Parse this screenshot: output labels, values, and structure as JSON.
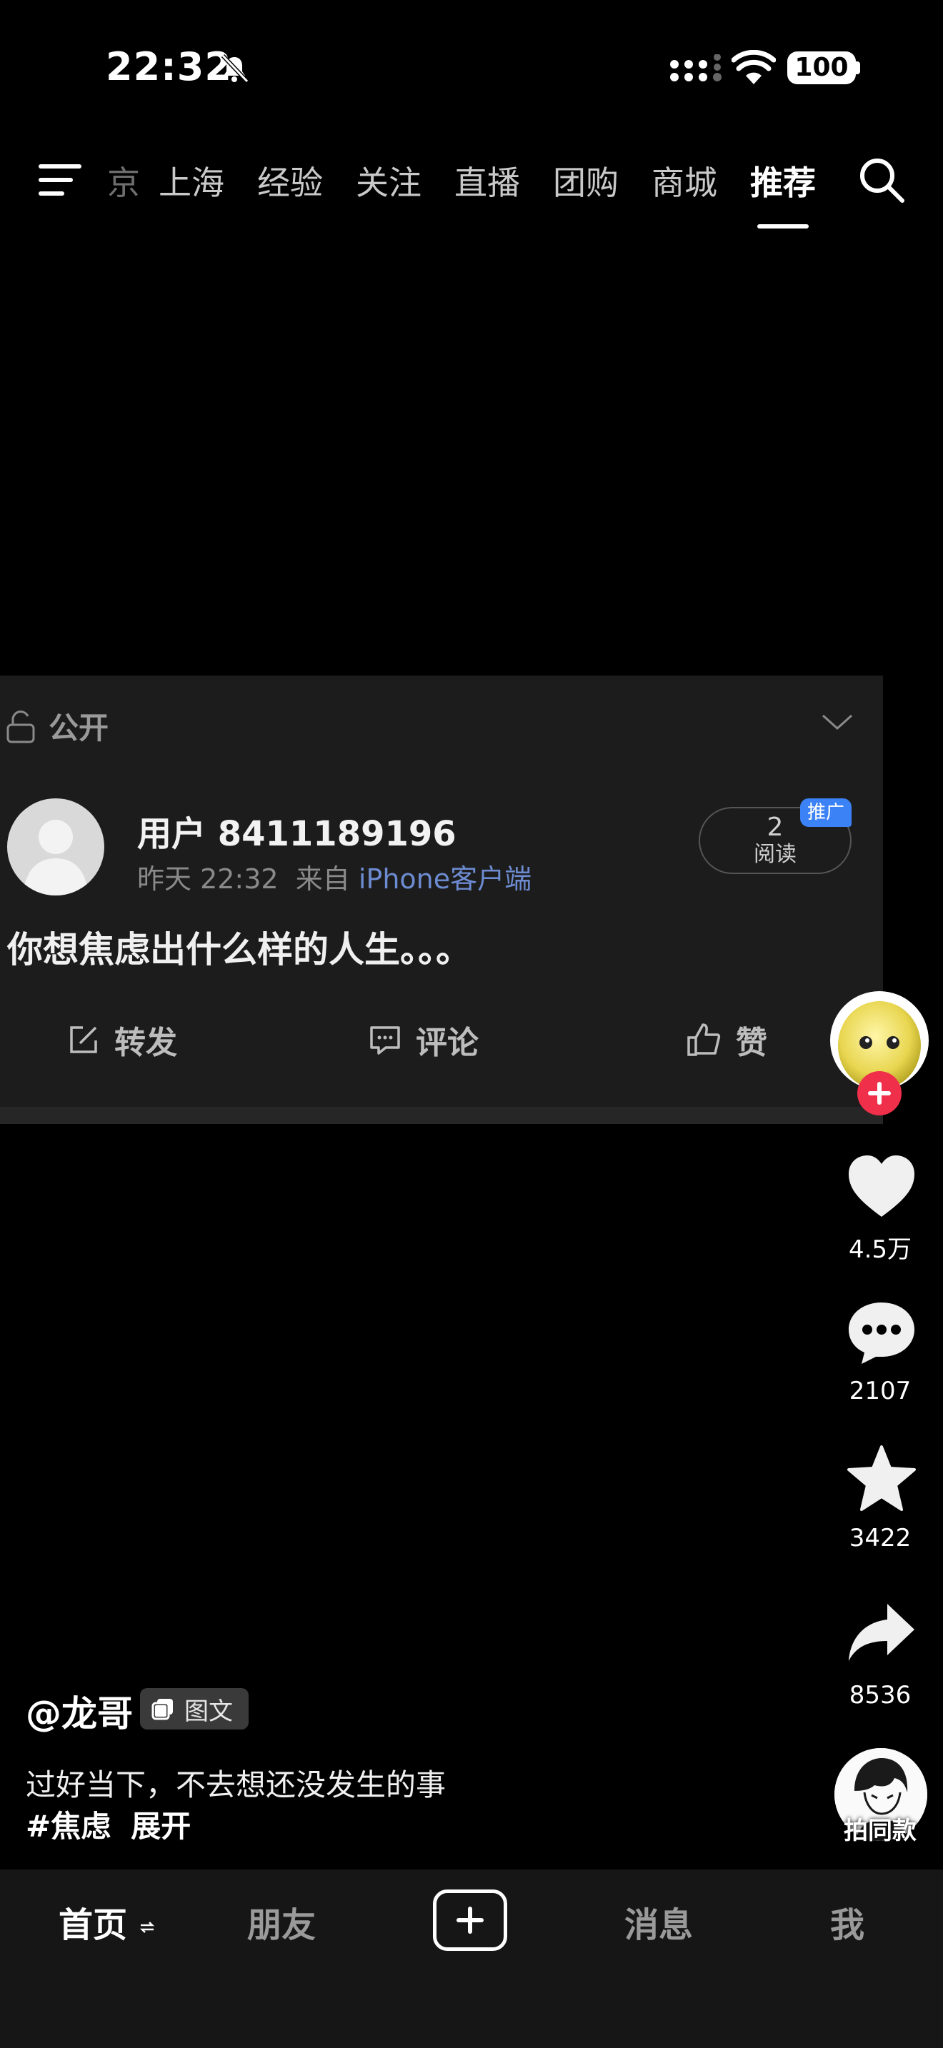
{
  "status_bar": {
    "time": "22:32",
    "battery": "100"
  },
  "top_nav": {
    "tabs": [
      {
        "label": "京",
        "state": "faded"
      },
      {
        "label": "上海",
        "state": "normal"
      },
      {
        "label": "经验",
        "state": "normal"
      },
      {
        "label": "关注",
        "state": "normal"
      },
      {
        "label": "直播",
        "state": "normal"
      },
      {
        "label": "团购",
        "state": "normal"
      },
      {
        "label": "商城",
        "state": "normal"
      },
      {
        "label": "推荐",
        "state": "active"
      }
    ]
  },
  "post_card": {
    "visibility": "公开",
    "author": "用户 8411189196",
    "time": "昨天 22:32",
    "source_prefix": "来自",
    "source": "iPhone客户端",
    "reads_count": "2",
    "reads_label": "阅读",
    "promo_badge": "推广",
    "text": "你想焦虑出什么样的人生。。。",
    "actions": {
      "repost": "转发",
      "comment": "评论",
      "like": "赞"
    }
  },
  "right_rail": {
    "likes": "4.5万",
    "comments": "2107",
    "favorites": "3422",
    "shares": "8536",
    "music_label": "拍同款"
  },
  "caption": {
    "author": "@龙哥",
    "type_tag": "图文",
    "text": "过好当下，不去想还没发生的事",
    "hashtag": "#焦虑",
    "expand": "展开"
  },
  "tab_bar": {
    "home": "首页",
    "friends": "朋友",
    "messages": "消息",
    "me": "我"
  }
}
